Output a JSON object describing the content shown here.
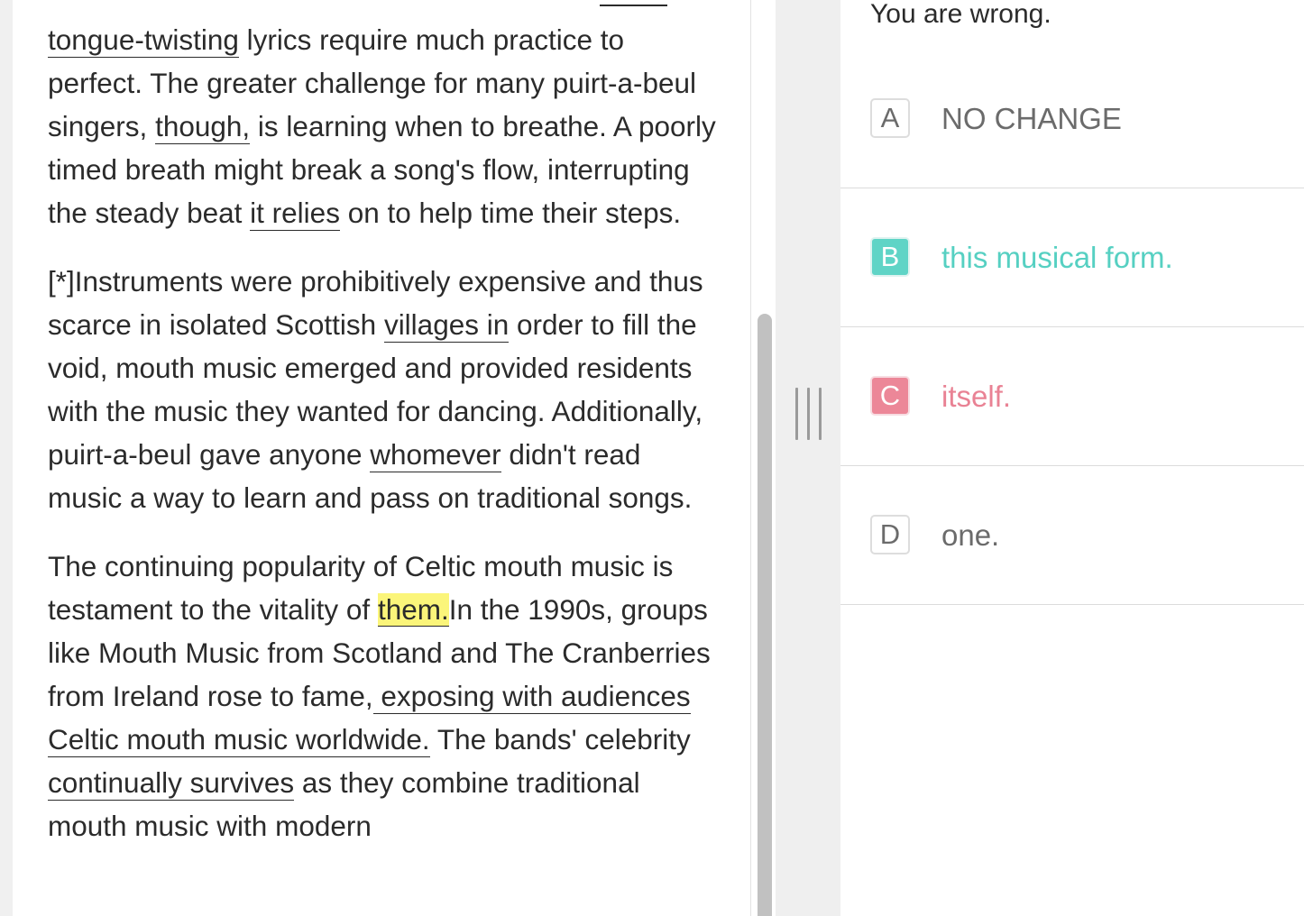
{
  "passage": {
    "p1": {
      "w1": "tongue-twisting",
      "t1": " lyrics require much practice to perfect. The greater challenge for many puirt-a-beul singers, ",
      "w2": "though,",
      "t2": " is learning when to breathe. A poorly timed breath might break a song's flow, interrupting the steady beat ",
      "w3": "it relies",
      "t3": " on to help time their steps."
    },
    "p2": {
      "t1": "[*]Instruments were prohibitively expensive and thus scarce in isolated Scottish ",
      "w1": "villages in",
      "t2": " order to fill the void, mouth music emerged and provided residents with the music they wanted for dancing. Additionally, puirt-a-beul gave anyone ",
      "w2": "whomever",
      "t3": " didn't read music a way to learn and pass on traditional songs."
    },
    "p3": {
      "t1": "The continuing popularity of Celtic mouth music is testament to the vitality of ",
      "hl": "them.",
      "t2": "In the 1990s, groups like Mouth Music from Scotland and The Cranberries from Ireland rose to fame,",
      "w1": " exposing with audiences Celtic mouth music worldwide.",
      "t3": " The bands' celebrity ",
      "w2": "continually survives",
      "t4": " as they combine traditional mouth music with modern"
    }
  },
  "feedback": "You are wrong.",
  "choices": [
    {
      "letter": "A",
      "text": "NO CHANGE",
      "state": "default"
    },
    {
      "letter": "B",
      "text": "this musical form.",
      "state": "correct"
    },
    {
      "letter": "C",
      "text": "itself.",
      "state": "wrong"
    },
    {
      "letter": "D",
      "text": "one.",
      "state": "default"
    }
  ],
  "colors": {
    "correct": "#5fd4c6",
    "wrong": "#ec8798",
    "highlight": "#fbf57a"
  }
}
